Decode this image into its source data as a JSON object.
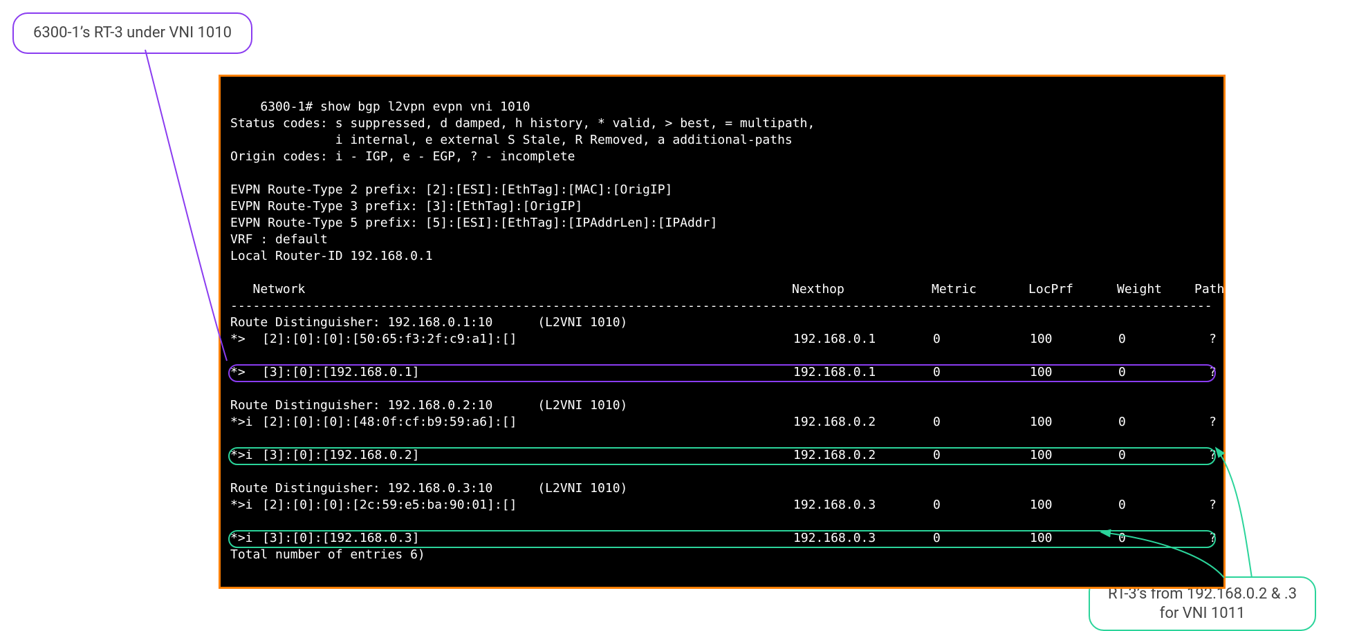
{
  "annotations": {
    "purple_label": "6300-1’s RT-3 under VNI 1010",
    "green_label_line1": "RT-3’s from 192.168.0.2 & .3",
    "green_label_line2": "for VNI 1011"
  },
  "terminal": {
    "command": "6300-1# show bgp l2vpn evpn vni 1010",
    "status_line1": "Status codes: s suppressed, d damped, h history, * valid, > best, = multipath,",
    "status_line2": "              i internal, e external S Stale, R Removed, a additional-paths",
    "origin_line": "Origin codes: i - IGP, e - EGP, ? - incomplete",
    "rt2": "EVPN Route-Type 2 prefix: [2]:[ESI]:[EthTag]:[MAC]:[OrigIP]",
    "rt3": "EVPN Route-Type 3 prefix: [3]:[EthTag]:[OrigIP]",
    "rt5": "EVPN Route-Type 5 prefix: [5]:[ESI]:[EthTag]:[IPAddrLen]:[IPAddr]",
    "vrf": "VRF : default",
    "router_id": "Local Router-ID 192.168.0.1",
    "headers": {
      "network": "   Network",
      "nexthop": "Nexthop",
      "metric": "Metric",
      "locprf": "LocPrf",
      "weight": "Weight",
      "path": "Path"
    },
    "divider": "-------------------------------------------------------------------------------------------------------------------------------------------",
    "blocks": [
      {
        "rd": "Route Distinguisher: 192.168.0.1:10",
        "vni": "(L2VNI 1010)",
        "rows": [
          {
            "status": "*>",
            "prefix": "[2]:[0]:[0]:[50:65:f3:2f:c9:a1]:[]",
            "next": "192.168.0.1",
            "metric": "0",
            "locprf": "100",
            "weight": "0",
            "path": "?",
            "hl": "none"
          },
          {
            "status": "*>",
            "prefix": "[3]:[0]:[192.168.0.1]",
            "next": "192.168.0.1",
            "metric": "0",
            "locprf": "100",
            "weight": "0",
            "path": "?",
            "hl": "purple"
          }
        ]
      },
      {
        "rd": "Route Distinguisher: 192.168.0.2:10",
        "vni": "(L2VNI 1010)",
        "rows": [
          {
            "status": "*>i",
            "prefix": "[2]:[0]:[0]:[48:0f:cf:b9:59:a6]:[]",
            "next": "192.168.0.2",
            "metric": "0",
            "locprf": "100",
            "weight": "0",
            "path": "?",
            "hl": "none"
          },
          {
            "status": "*>i",
            "prefix": "[3]:[0]:[192.168.0.2]",
            "next": "192.168.0.2",
            "metric": "0",
            "locprf": "100",
            "weight": "0",
            "path": "?",
            "hl": "green"
          }
        ]
      },
      {
        "rd": "Route Distinguisher: 192.168.0.3:10",
        "vni": "(L2VNI 1010)",
        "rows": [
          {
            "status": "*>i",
            "prefix": "[2]:[0]:[0]:[2c:59:e5:ba:90:01]:[]",
            "next": "192.168.0.3",
            "metric": "0",
            "locprf": "100",
            "weight": "0",
            "path": "?",
            "hl": "none"
          },
          {
            "status": "*>i",
            "prefix": "[3]:[0]:[192.168.0.3]",
            "next": "192.168.0.3",
            "metric": "0",
            "locprf": "100",
            "weight": "0",
            "path": "?",
            "hl": "green"
          }
        ]
      }
    ],
    "total": "Total number of entries 6)"
  }
}
